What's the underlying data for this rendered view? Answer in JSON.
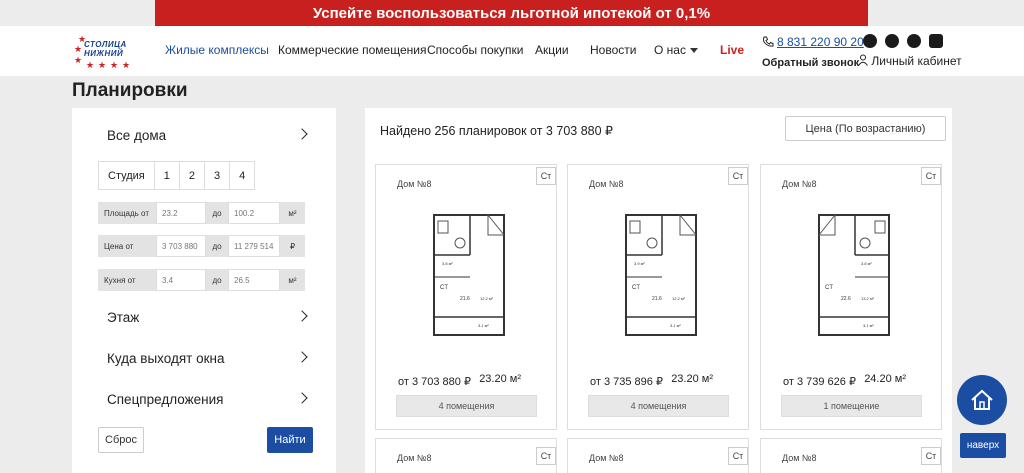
{
  "promo": {
    "text": "Успейте воспользоваться льготной ипотекой от 0,1%"
  },
  "logo": {
    "line1": "СТОЛИЦА",
    "line2": "НИЖНИЙ"
  },
  "nav": {
    "items": [
      "Жилые комплексы",
      "Коммерческие помещения",
      "Способы покупки",
      "Акции",
      "Новости",
      "О нас",
      "Live"
    ]
  },
  "contacts": {
    "phone": "8 831 220 90 20",
    "callback": "Обратный звонок",
    "cabinet": "Личный кабинет"
  },
  "social": [
    "vk-icon",
    "ok-icon",
    "viber-icon",
    "telegram-icon",
    "plus-icon"
  ],
  "page": {
    "title": "Планировки"
  },
  "filter": {
    "all_houses": "Все дома",
    "rooms": [
      "Студия",
      "1",
      "2",
      "3",
      "4"
    ],
    "area": {
      "label": "Площадь от",
      "from": "23.2",
      "to_label": "до",
      "to": "100.2",
      "unit": "м²"
    },
    "price": {
      "label": "Цена от",
      "from": "3 703 880",
      "to_label": "до",
      "to": "11 279 514",
      "unit": "₽"
    },
    "kitchen": {
      "label": "Кухня от",
      "from": "3.4",
      "to_label": "до",
      "to": "26.5",
      "unit": "м²"
    },
    "floor": "Этаж",
    "windows": "Куда выходят окна",
    "special": "Спецпредложения",
    "reset": "Сброс",
    "find": "Найти"
  },
  "results": {
    "found": "Найдено 256 планировок от 3 703 880 ₽",
    "sort": "Цена (По возрастанию)",
    "cards": [
      {
        "house": "Дом №8",
        "tag": "Ст",
        "price": "от 3 703 880 ₽",
        "area": "23.20 м²",
        "rooms": "4 помещения"
      },
      {
        "house": "Дом №8",
        "tag": "Ст",
        "price": "от 3 735 896 ₽",
        "area": "23.20 м²",
        "rooms": "4 помещения"
      },
      {
        "house": "Дом №8",
        "tag": "Ст",
        "price": "от 3 739 626 ₽",
        "area": "24.20 м²",
        "rooms": "1 помещение"
      }
    ],
    "cards_row2": [
      {
        "house": "Дом №8",
        "tag": "Ст"
      },
      {
        "house": "Дом №8",
        "tag": "Ст"
      },
      {
        "house": "Дом №8",
        "tag": "Ст"
      }
    ]
  },
  "up_button": "наверх",
  "colors": {
    "brand_red": "#c8201e",
    "brand_blue": "#1b4ea3"
  }
}
